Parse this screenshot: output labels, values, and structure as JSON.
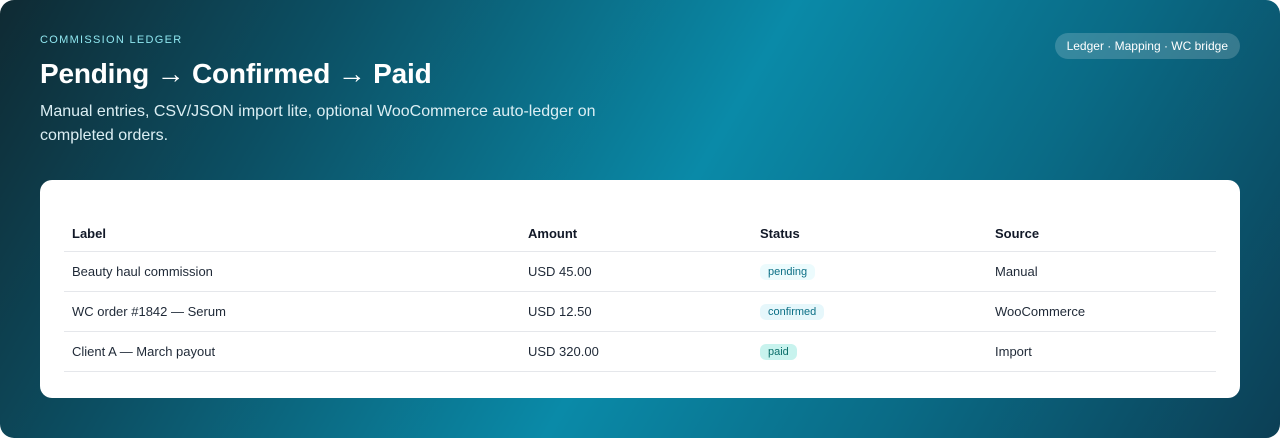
{
  "header": {
    "eyebrow": "Commission Ledger",
    "title": "Pending → Confirmed → Paid",
    "subtitle": "Manual entries, CSV/JSON import lite, optional WooCommerce auto-ledger on completed orders.",
    "pill": "Ledger · Mapping · WC bridge"
  },
  "table": {
    "columns": [
      "Label",
      "Amount",
      "Status",
      "Source"
    ],
    "rows": [
      {
        "label": "Beauty haul commission",
        "amount": "USD 45.00",
        "status": "pending",
        "source": "Manual"
      },
      {
        "label": "WC order #1842 — Serum",
        "amount": "USD 12.50",
        "status": "confirmed",
        "source": "WooCommerce"
      },
      {
        "label": "Client A — March payout",
        "amount": "USD 320.00",
        "status": "paid",
        "source": "Import"
      }
    ]
  },
  "colors": {
    "accent": "#0a8aa8",
    "status_pending": "#0b6f85",
    "status_paid_bg": "#c8f3ee"
  }
}
